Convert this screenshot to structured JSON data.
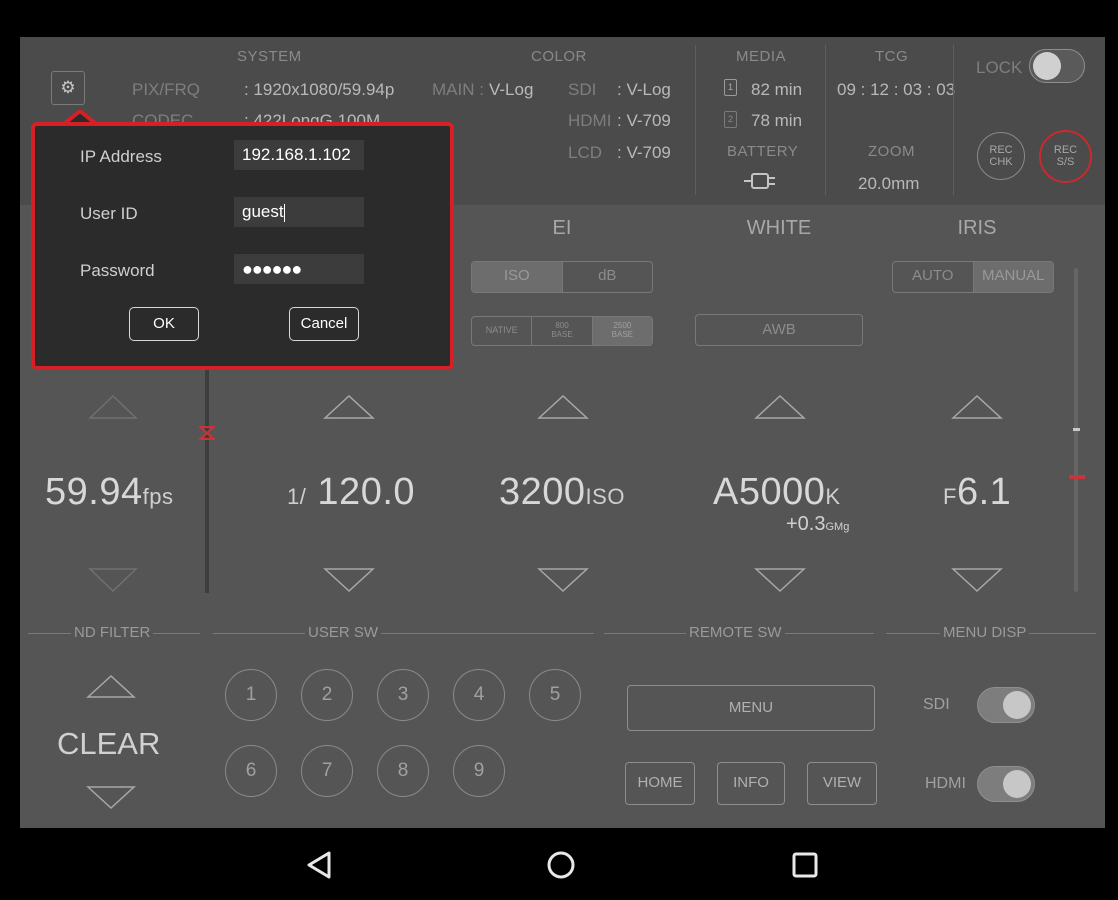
{
  "header": {
    "system_title": "SYSTEM",
    "color_title": "COLOR",
    "media_title": "MEDIA",
    "tcg_title": "TCG",
    "battery_title": "BATTERY",
    "zoom_title": "ZOOM",
    "pixfrq_label": "PIX/FRQ",
    "pixfrq_value": ": 1920x1080/59.94p",
    "codec_label": "CODEC",
    "codec_value": ": 422LongG 100M",
    "main_label": "MAIN :",
    "main_value": "V-Log",
    "sdi_label": "SDI",
    "sdi_value": ": V-Log",
    "hdmi_label": "HDMI",
    "hdmi_value": ": V-709",
    "lcd_label": "LCD",
    "lcd_value": ": V-709",
    "media1_num": "1",
    "media1_value": "82 min",
    "media2_num": "2",
    "media2_value": "78 min",
    "tcg_value": "09 : 12 : 03 : 03",
    "zoom_value": "20.0mm",
    "lock_label": "LOCK",
    "rec_chk_label_1": "REC",
    "rec_chk_label_2": "CHK",
    "rec_ss_label_1": "REC",
    "rec_ss_label_2": "S/S"
  },
  "columns": {
    "ei_title": "EI",
    "white_title": "WHITE",
    "iris_title": "IRIS",
    "ei_iso": "ISO",
    "ei_db": "dB",
    "native": "NATIVE",
    "base800_1": "800",
    "base800_2": "BASE",
    "base2500_1": "2500",
    "base2500_2": "BASE",
    "awb": "AWB",
    "iris_auto": "AUTO",
    "iris_manual": "MANUAL"
  },
  "values": {
    "fps_value": "59.94",
    "fps_unit": "fps",
    "shutter_prefix": "1/",
    "shutter_value": "120.0",
    "ei_value": "3200",
    "ei_unit": "ISO",
    "white_value": "A5000",
    "white_unit": "K",
    "white_gmg": "+0.3",
    "white_gmg_unit": "GMg",
    "iris_prefix": "F",
    "iris_value": "6.1"
  },
  "sections": {
    "nd_filter": "ND FILTER",
    "user_sw": "USER SW",
    "remote_sw": "REMOTE SW",
    "menu_disp": "MENU DISP",
    "nd_value": "CLEAR",
    "user_buttons": [
      "1",
      "2",
      "3",
      "4",
      "5",
      "6",
      "7",
      "8",
      "9"
    ],
    "menu_button": "MENU",
    "home_button": "HOME",
    "info_button": "INFO",
    "view_button": "VIEW",
    "sdi_label": "SDI",
    "hdmi_label": "HDMI"
  },
  "dialog": {
    "ip_label": "IP Address",
    "ip_value": "192.168.1.102",
    "user_label": "User ID",
    "user_value": "guest",
    "password_label": "Password",
    "password_value": "●●●●●●",
    "ok_button": "OK",
    "cancel_button": "Cancel"
  },
  "colors": {
    "accent_red": "#d62026",
    "panel_bg": "#555555",
    "header_bg": "#4b4b4b"
  }
}
